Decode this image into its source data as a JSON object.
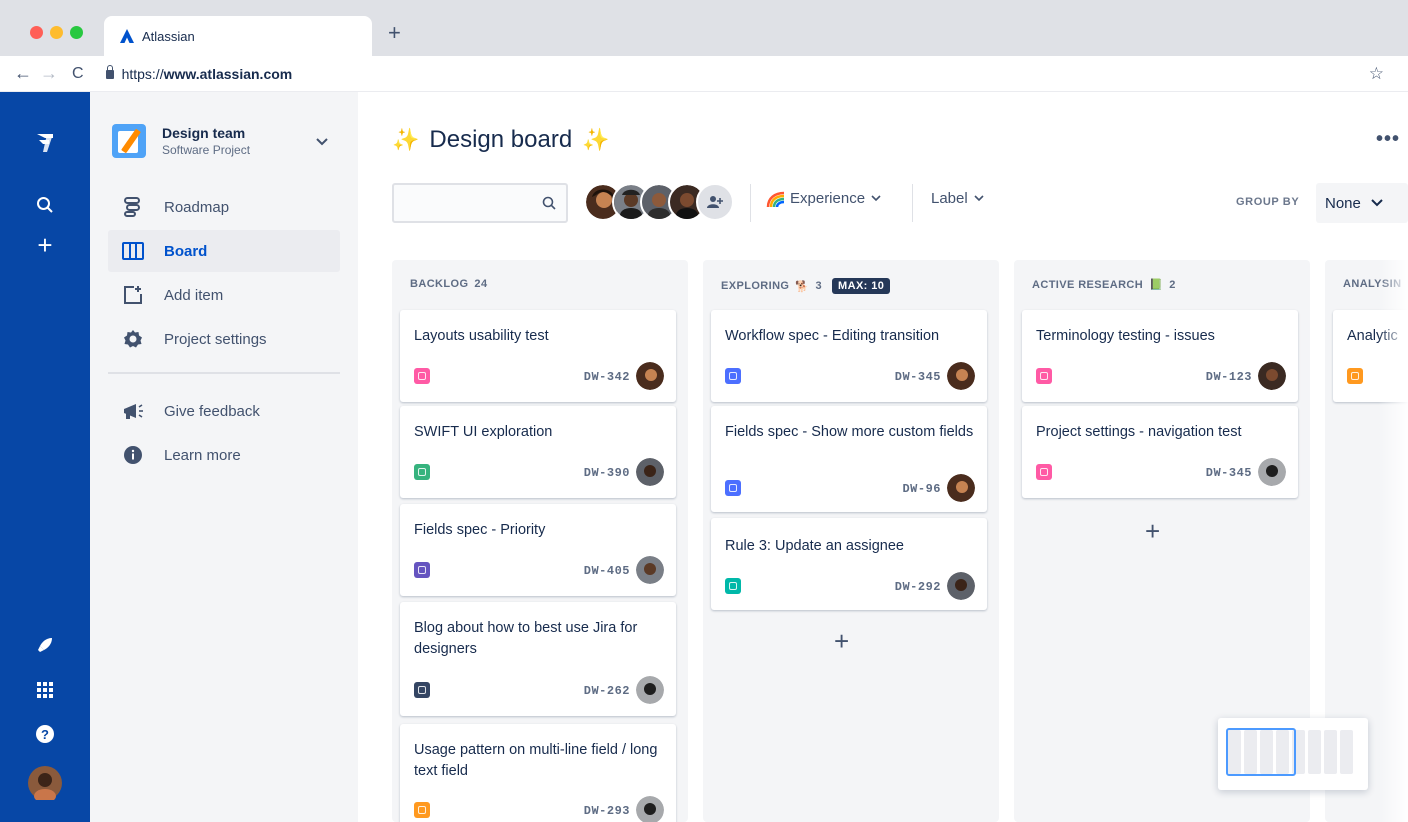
{
  "browser": {
    "tab_title": "Atlassian",
    "new_tab": "+",
    "url_prefix": "https://",
    "url_domain": "www.atlassian.com",
    "back": "←",
    "forward": "→",
    "reload": "C",
    "bookmark": "☆"
  },
  "global_nav": {
    "plus": "+",
    "help": "?"
  },
  "project": {
    "name": "Design team",
    "type": "Software Project"
  },
  "sidebar": {
    "items": [
      {
        "label": "Roadmap",
        "icon": "roadmap-icon"
      },
      {
        "label": "Board",
        "icon": "board-icon",
        "active": true
      },
      {
        "label": "Add item",
        "icon": "add-item-icon"
      },
      {
        "label": "Project settings",
        "icon": "gear-icon"
      },
      {
        "label": "Give feedback",
        "icon": "megaphone-icon"
      },
      {
        "label": "Learn more",
        "icon": "info-icon"
      }
    ]
  },
  "board": {
    "title": "Design board",
    "title_decoration": "✨",
    "more": "•••",
    "search_placeholder": "",
    "filters": {
      "experience": "Experience",
      "label": "Label",
      "group_by_label": "GROUP BY",
      "group_by_value": "None"
    },
    "columns": [
      {
        "name": "BACKLOG",
        "count": "24",
        "cards": [
          {
            "title": "Layouts usability test",
            "key": "DW-342",
            "type_color": "#ff5aa5"
          },
          {
            "title": "SWIFT UI exploration",
            "key": "DW-390",
            "type_color": "#36b37e"
          },
          {
            "title": "Fields spec - Priority",
            "key": "DW-405",
            "type_color": "#6554c0"
          },
          {
            "title": "Blog about how to best use Jira for designers",
            "key": "DW-262",
            "type_color": "#344563"
          },
          {
            "title": "Usage pattern on multi-line field / long text field",
            "key": "DW-293",
            "type_color": "#ff991f"
          }
        ]
      },
      {
        "name": "EXPLORING",
        "emoji": "🐕",
        "count": "3",
        "max_badge": "MAX: 10",
        "cards": [
          {
            "title": "Workflow spec - Editing transition",
            "key": "DW-345",
            "type_color": "#4c6fff"
          },
          {
            "title": "Fields spec - Show more custom fields",
            "key": "DW-96",
            "type_color": "#4c6fff"
          },
          {
            "title": "Rule 3: Update an assignee",
            "key": "DW-292",
            "type_color": "#00b8a9"
          }
        ]
      },
      {
        "name": "ACTIVE RESEARCH",
        "emoji": "📗",
        "count": "2",
        "cards": [
          {
            "title": "Terminology testing - issues",
            "key": "DW-123",
            "type_color": "#ff5aa5"
          },
          {
            "title": "Project settings - navigation test",
            "key": "DW-345",
            "type_color": "#ff5aa5"
          }
        ]
      },
      {
        "name": "ANALYSIN",
        "count": "",
        "cards": [
          {
            "title": "Analytic",
            "key": "",
            "type_color": "#ff991f"
          }
        ]
      }
    ],
    "add_card": "+"
  },
  "colors": {
    "global_nav": "#0747a6",
    "active_text": "#0052cc",
    "sidebar_bg": "#f4f5f7",
    "column_bg": "#f4f5f7"
  }
}
